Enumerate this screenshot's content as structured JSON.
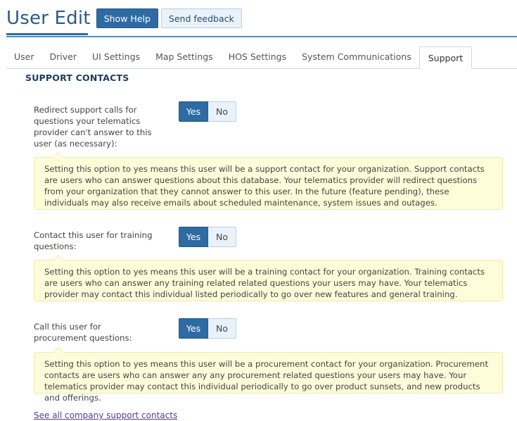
{
  "header": {
    "title": "User Edit",
    "show_help": "Show Help",
    "send_feedback": "Send feedback"
  },
  "tabs": [
    {
      "label": "User"
    },
    {
      "label": "Driver"
    },
    {
      "label": "UI Settings"
    },
    {
      "label": "Map Settings"
    },
    {
      "label": "HOS Settings"
    },
    {
      "label": "System Communications"
    },
    {
      "label": "Support",
      "active": true
    }
  ],
  "section": {
    "title": "SUPPORT CONTACTS"
  },
  "settings": [
    {
      "label": "Redirect support calls for questions your telematics provider can't answer to this user (as necessary):",
      "yes": "Yes",
      "no": "No",
      "selected": "Yes",
      "note": "Setting this option to yes means this user will be a support contact for your organization. Support contacts are users who can answer questions about this database. Your telematics provider will redirect questions from your organization that they cannot answer to this user. In the future (feature pending), these individuals may also receive emails about scheduled maintenance, system issues and outages."
    },
    {
      "label": "Contact this user for training questions:",
      "yes": "Yes",
      "no": "No",
      "selected": "Yes",
      "note": "Setting this option to yes means this user will be a training contact for your organization. Training contacts are users who can answer any training related related questions your users may have. Your telematics provider may contact this individual listed periodically to go over new features and general training."
    },
    {
      "label": "Call this user for procurement questions:",
      "yes": "Yes",
      "no": "No",
      "selected": "Yes",
      "note": "Setting this option to yes means this user will be a procurement contact for your organization. Procurement contacts are users who can answer any any procurement related questions your users may have. Your telematics provider may contact this individual periodically to go over product sunsets, and new products and offerings."
    }
  ],
  "footer": {
    "link": "See all company support contacts"
  },
  "colors": {
    "accent": "#2e6ba3",
    "note_bg": "#fefcd9",
    "link": "#5a3b8c"
  }
}
